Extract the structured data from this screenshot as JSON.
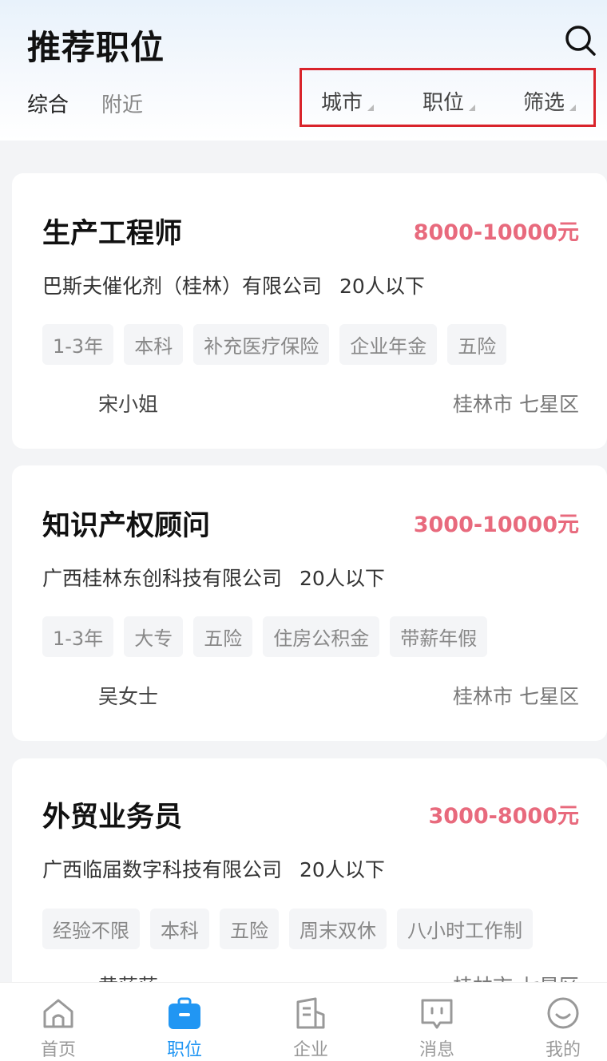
{
  "header": {
    "title": "推荐职位",
    "tabs": [
      {
        "label": "综合",
        "active": true
      },
      {
        "label": "附近",
        "active": false
      }
    ],
    "filters": [
      {
        "label": "城市"
      },
      {
        "label": "职位"
      },
      {
        "label": "筛选"
      }
    ],
    "search_icon": "search-icon"
  },
  "jobs": [
    {
      "title": "生产工程师",
      "salary": "8000-10000元",
      "company": "巴斯夫催化剂（桂林）有限公司",
      "size": "20人以下",
      "tags": [
        "1-3年",
        "本科",
        "补充医疗保险",
        "企业年金",
        "五险"
      ],
      "contact": "宋小姐",
      "location": "桂林市 七星区"
    },
    {
      "title": "知识产权顾问",
      "salary": "3000-10000元",
      "company": "广西桂林东创科技有限公司",
      "size": "20人以下",
      "tags": [
        "1-3年",
        "大专",
        "五险",
        "住房公积金",
        "带薪年假"
      ],
      "contact": "吴女士",
      "location": "桂林市 七星区"
    },
    {
      "title": "外贸业务员",
      "salary": "3000-8000元",
      "company": "广西临届数字科技有限公司",
      "size": "20人以下",
      "tags": [
        "经验不限",
        "本科",
        "五险",
        "周末双休",
        "八小时工作制"
      ],
      "contact": "黄莎莎",
      "location": "桂林市 七星区"
    }
  ],
  "nav": {
    "items": [
      {
        "label": "首页",
        "icon": "home-icon",
        "active": false
      },
      {
        "label": "职位",
        "icon": "briefcase-icon",
        "active": true
      },
      {
        "label": "企业",
        "icon": "building-icon",
        "active": false
      },
      {
        "label": "消息",
        "icon": "message-icon",
        "active": false
      },
      {
        "label": "我的",
        "icon": "profile-icon",
        "active": false
      }
    ]
  },
  "colors": {
    "accent": "#2196f3",
    "salary": "#e86a7d",
    "highlight_box": "#d9242b"
  }
}
